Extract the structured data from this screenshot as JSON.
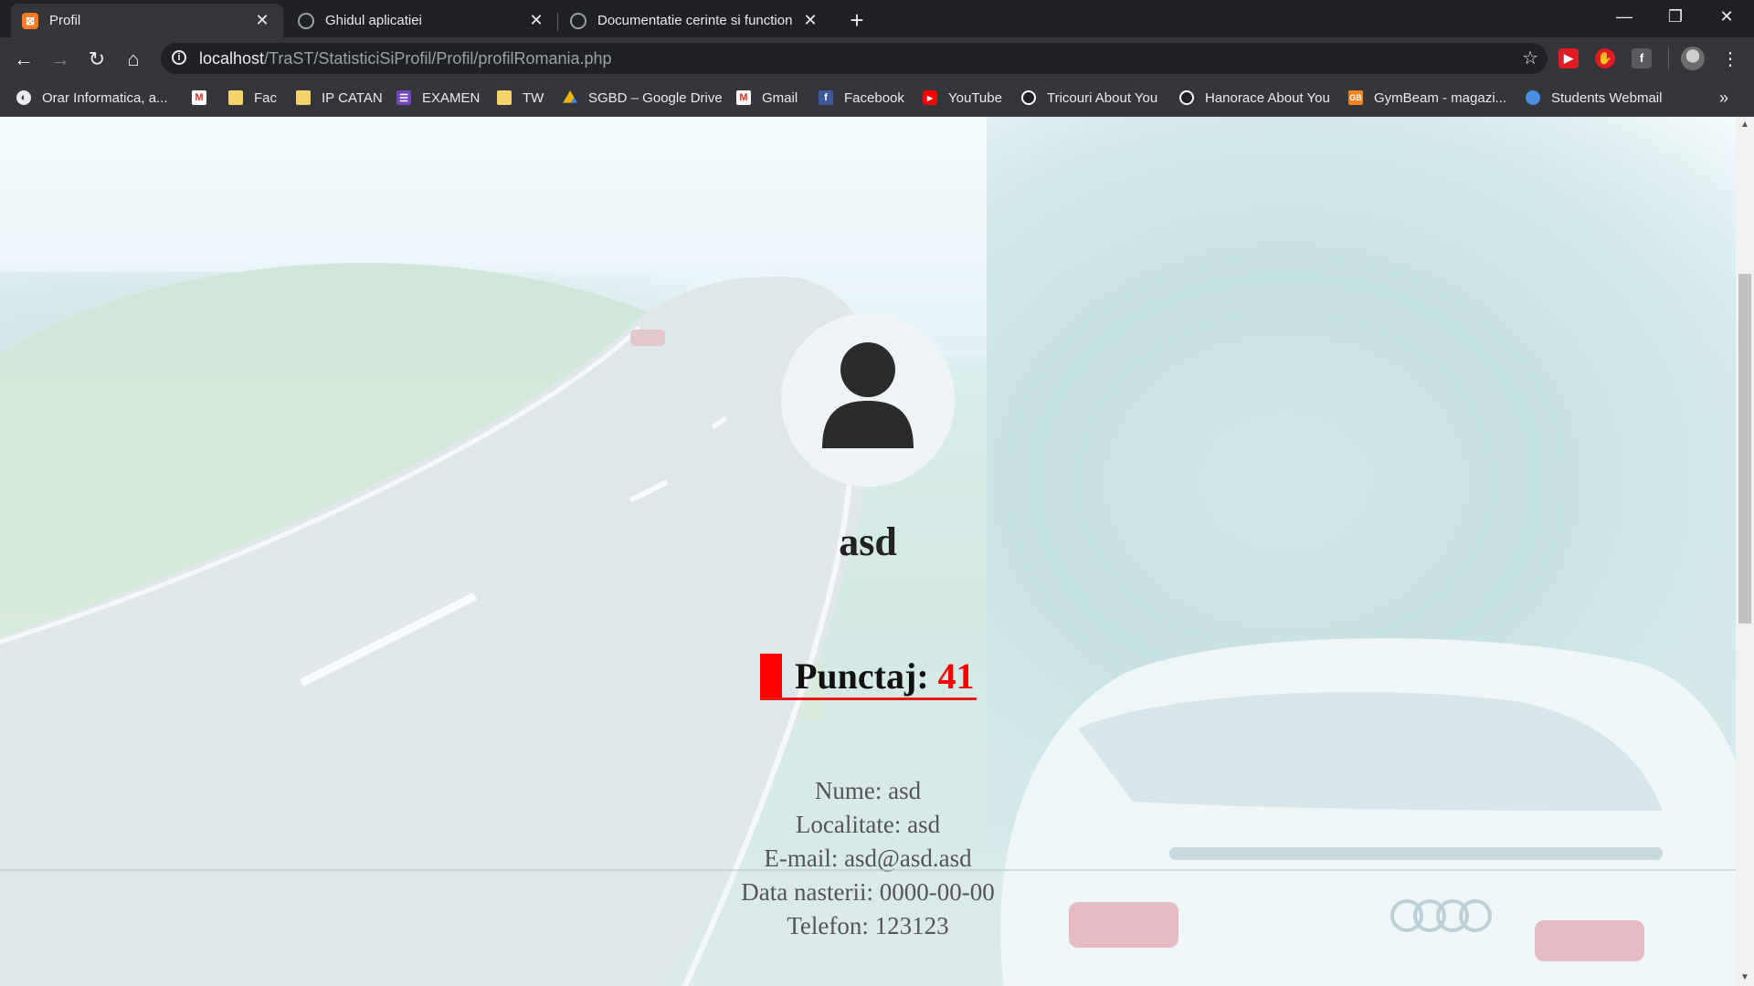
{
  "tabs": [
    {
      "title": "Profil",
      "favicon": "xampp-icon",
      "active": true
    },
    {
      "title": "Ghidul aplicatiei",
      "favicon": "globe-icon",
      "active": false
    },
    {
      "title": "Documentatie cerinte si function",
      "favicon": "globe-icon",
      "active": false
    }
  ],
  "toolbar": {
    "url_host": "localhost",
    "url_path": "/TraST/StatisticiSiProfil/Profil/profilRomania.php"
  },
  "bookmarks": [
    {
      "label": "Orar Informatica, a...",
      "icon": "globe-icon"
    },
    {
      "label": "",
      "icon": "gmail-icon"
    },
    {
      "label": "Fac",
      "icon": "folder-icon"
    },
    {
      "label": "IP CATAN",
      "icon": "folder-icon"
    },
    {
      "label": "EXAMEN",
      "icon": "list-icon"
    },
    {
      "label": "TW",
      "icon": "folder-icon"
    },
    {
      "label": "SGBD – Google Drive",
      "icon": "drive-icon"
    },
    {
      "label": "Gmail",
      "icon": "gmail-icon"
    },
    {
      "label": "Facebook",
      "icon": "facebook-icon"
    },
    {
      "label": "YouTube",
      "icon": "youtube-icon"
    },
    {
      "label": "Tricouri About You",
      "icon": "aboutyou-icon"
    },
    {
      "label": "Hanorace About You",
      "icon": "aboutyou-icon"
    },
    {
      "label": "GymBeam - magazi...",
      "icon": "gymbeam-icon"
    },
    {
      "label": "Students Webmail",
      "icon": "webmail-icon"
    }
  ],
  "profile": {
    "username": "asd",
    "score_label": "Punctaj:",
    "score_value": "41",
    "details": [
      "Nume: asd",
      "Localitate: asd",
      "E-mail: asd@asd.asd",
      "Data nasterii: 0000-00-00",
      "Telefon: 123123"
    ]
  },
  "colors": {
    "accent_red": "#ff0000",
    "chrome_dark": "#202124",
    "chrome_toolbar": "#35363a"
  }
}
